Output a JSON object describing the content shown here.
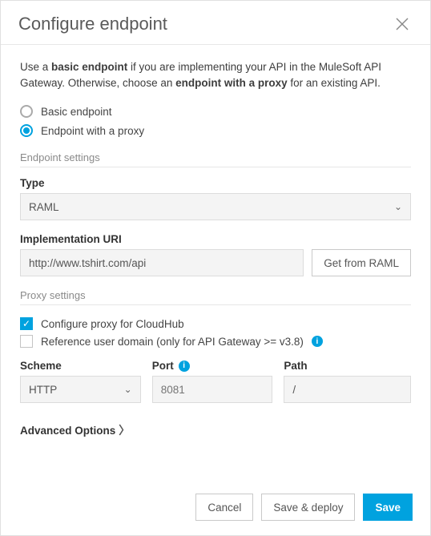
{
  "header": {
    "title": "Configure endpoint"
  },
  "intro": {
    "part1": "Use a ",
    "bold1": "basic endpoint",
    "part2": " if you are implementing your API in the MuleSoft API Gateway. Otherwise, choose an ",
    "bold2": "endpoint with a proxy",
    "part3": " for an existing API."
  },
  "endpointType": {
    "basic_label": "Basic endpoint",
    "proxy_label": "Endpoint with a proxy"
  },
  "endpointSettings": {
    "heading": "Endpoint settings",
    "type_label": "Type",
    "type_value": "RAML",
    "impl_uri_label": "Implementation URI",
    "impl_uri_value": "http://www.tshirt.com/api",
    "get_from_raml_label": "Get from RAML"
  },
  "proxySettings": {
    "heading": "Proxy settings",
    "cloudhub_label": "Configure proxy for CloudHub",
    "domain_label": "Reference user domain (only for API Gateway >= v3.8)",
    "scheme_label": "Scheme",
    "scheme_value": "HTTP",
    "port_label": "Port",
    "port_placeholder": "8081",
    "path_label": "Path",
    "path_value": "/"
  },
  "advanced": {
    "label": "Advanced Options"
  },
  "footer": {
    "cancel": "Cancel",
    "save_deploy": "Save & deploy",
    "save": "Save"
  }
}
